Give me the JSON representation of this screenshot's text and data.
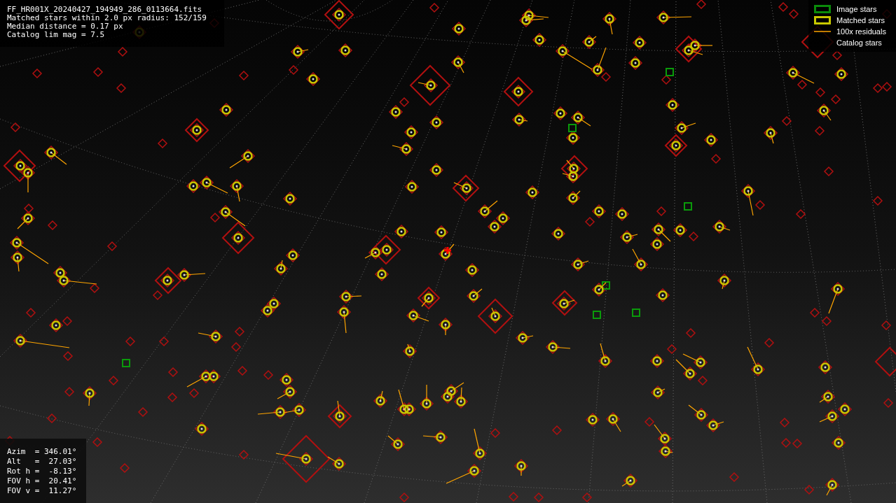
{
  "info_panel": {
    "lines": [
      "FF_HR001X_20240427_194949_286_0113664.fits",
      "Matched stars within 2.0 px radius: 152/159",
      "Median distance = 0.17 px",
      "Catalog lim mag = 7.5"
    ]
  },
  "legend": [
    {
      "kind": "image",
      "label": "Image stars"
    },
    {
      "kind": "matched",
      "label": "Matched stars"
    },
    {
      "kind": "residual",
      "label": "100x residuals"
    },
    {
      "kind": "catalog",
      "label": "Catalog stars"
    }
  ],
  "pointing_panel": {
    "lines": [
      "Azim  = 346.01°",
      "Alt   =  27.03°",
      "Rot h =  -8.13°",
      "FOV h =  20.41°",
      "FOV v =  11.27°"
    ]
  }
}
